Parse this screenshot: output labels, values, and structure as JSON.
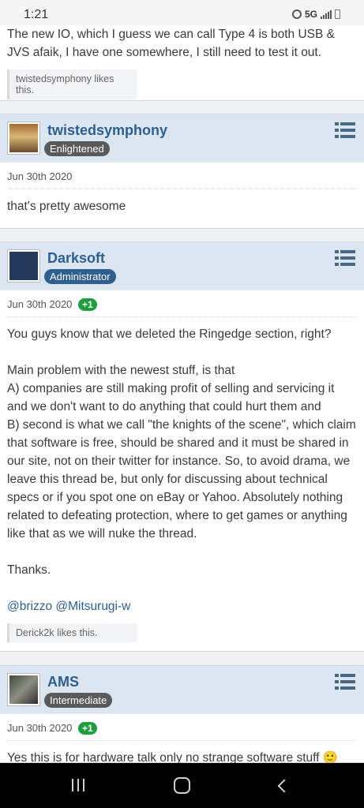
{
  "status_bar": {
    "time": "1:21",
    "network": "5G"
  },
  "posts": [
    {
      "username": "",
      "badge": "",
      "date": "",
      "body": [
        "The new IO, which I guess we can call Type 4 is both USB & JVS afaik, I have one somewhere, I still need to test it out."
      ],
      "likes": "twistedsymphony likes this."
    },
    {
      "username": "twistedsymphony",
      "badge": "Enlightened",
      "date": "Jun 30th 2020",
      "body": [
        "that's pretty awesome"
      ]
    },
    {
      "username": "Darksoft",
      "badge": "Administrator",
      "date": "Jun 30th 2020",
      "reaction": "+1",
      "body": [
        "You guys know that we deleted the Ringedge section, right?",
        "",
        "Main problem with the newest stuff, is that",
        "A) companies are still making profit of selling and servicing it and we don't want to do anything that could hurt them and",
        "B) second is what we call \"the knights of the scene\", which claim that software is free, should be shared and it must be shared in our site, not on their twitter for instance. So, to avoid drama, we leave this thread be, but only for discussing about technical specs or if you spot one on eBay or Yahoo. Absolutely nothing related to defeating protection, where to get games or anything like that as we will nuke the thread.",
        "",
        "Thanks.",
        ""
      ],
      "mentions": "@brizzo @Mitsurugi-w",
      "likes": "Derick2k likes this."
    },
    {
      "username": "AMS",
      "badge": "Intermediate",
      "date": "Jun 30th 2020",
      "reaction": "+1",
      "body": [
        "Yes this is for hardware talk only no strange software stuff 🙂"
      ]
    }
  ],
  "colors": {
    "accent": "#2c5f91",
    "header_bg": "#dbe6f1",
    "reaction_green": "#1e9e3d"
  }
}
